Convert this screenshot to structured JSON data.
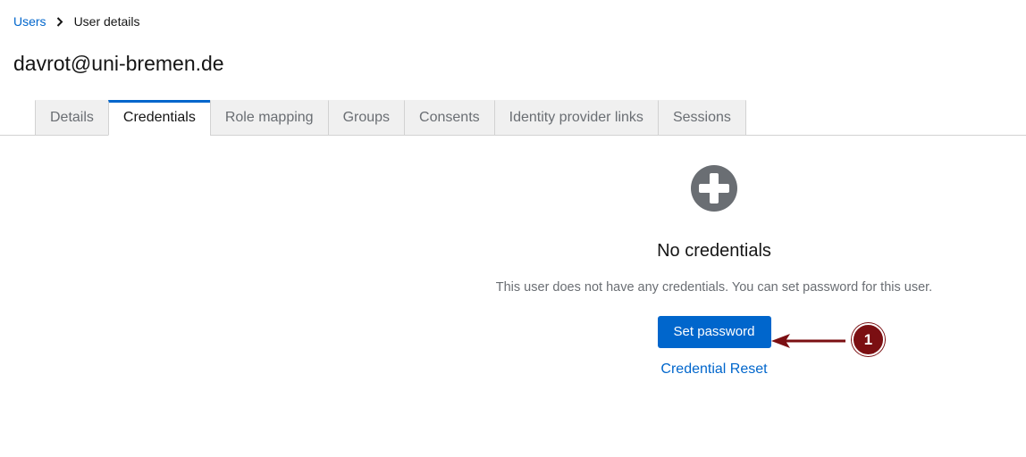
{
  "breadcrumb": {
    "parent": "Users",
    "current": "User details"
  },
  "page": {
    "title": "davrot@uni-bremen.de"
  },
  "tabs": [
    {
      "label": "Details",
      "active": false
    },
    {
      "label": "Credentials",
      "active": true
    },
    {
      "label": "Role mapping",
      "active": false
    },
    {
      "label": "Groups",
      "active": false
    },
    {
      "label": "Consents",
      "active": false
    },
    {
      "label": "Identity provider links",
      "active": false
    },
    {
      "label": "Sessions",
      "active": false
    }
  ],
  "empty_state": {
    "icon": "plus-circle-icon",
    "title": "No credentials",
    "body": "This user does not have any credentials. You can set password for this user.",
    "primary_action": "Set password",
    "secondary_action": "Credential Reset"
  },
  "annotation": {
    "marker": "1",
    "color": "#7b0f12"
  },
  "colors": {
    "accent": "#0066cc",
    "muted_text": "#6a6e73",
    "tab_bg": "#f0f0f0",
    "icon_gray": "#6a6e73"
  }
}
